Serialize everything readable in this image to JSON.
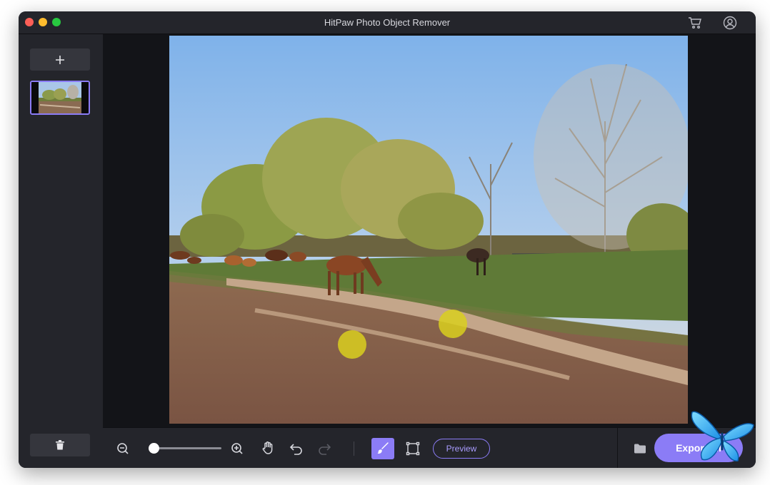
{
  "window": {
    "title": "HitPaw Photo Object Remover"
  },
  "header": {
    "icons": [
      "cart-icon",
      "user-icon"
    ]
  },
  "sidebar": {
    "add_icon": "plus-icon",
    "delete_icon": "trash-icon"
  },
  "toolbar": {
    "zoom_level": 0.05,
    "tools": [
      "zoom-out-icon",
      "zoom-in-icon",
      "hand-icon",
      "undo-icon",
      "redo-icon",
      "brush-icon",
      "box-select-icon"
    ],
    "preview_label": "Preview",
    "folder_icon": "folder-icon",
    "export_label": "Export all"
  },
  "colors": {
    "accent": "#8b7cf6",
    "window_bg": "#17181d",
    "panel_bg": "#24252b",
    "mask": "#d9cf1f"
  }
}
